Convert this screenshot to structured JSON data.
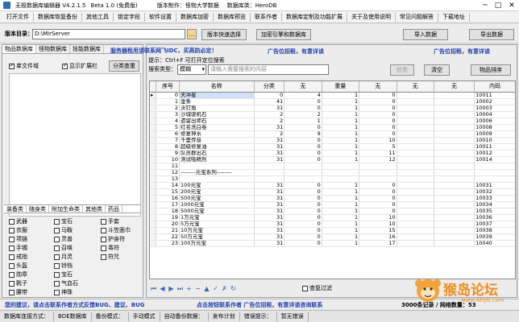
{
  "window": {
    "app_name": "无极数据库编辑器 V4.2.1.5",
    "version": "Beta 1.0 (免费版)",
    "author": "版本制作：怪物大学数据",
    "db_type": "数据库类：HeroDB",
    "minimize": "─",
    "maximize": "□",
    "close": "✕"
  },
  "menu": [
    "打开文件",
    "数据库恢复备份",
    "其他工具",
    "锁定字段",
    "软件设置",
    "数据库加密",
    "数据库预览",
    "联系作者",
    "数据库定制及功能扩展",
    "关于及使用说明",
    "常见问题解答",
    "下载地址"
  ],
  "rootbar": {
    "label": "版本目录：",
    "path": "D:\\MirServer",
    "browse_icon": "…",
    "version_button": "版本快速选择",
    "encrypt_button": "加密引擎和数据库",
    "import_button": "导入数据",
    "export_button": "导出数据"
  },
  "left": {
    "tabs": [
      "物品数据库",
      "怪物数据库",
      "技能数据库"
    ],
    "ad_text": "服务器租用请联系网飞IDC，买高防必定！",
    "checkbox_single": "单文件域",
    "checkbox_show_all": "显示扩展栏",
    "classify_button": "分类查重",
    "bottom_tabs": [
      "装备类",
      "随身类",
      "附加生命类",
      "其他类",
      "药品"
    ],
    "items": [
      "武器",
      "衣服",
      "项链",
      "手镯",
      "戒指",
      "头盔",
      "勋章",
      "靴子",
      "腰带",
      "宝石",
      "马鞍",
      "灵兽",
      "召唤",
      "月灵",
      "铃铛",
      "宝石",
      "气血石",
      "神珠",
      "手套",
      "斗笠面巾",
      "护身符",
      "毒符",
      "符咒"
    ]
  },
  "main": {
    "ad_left": "广告位招租，有意详谈",
    "ad_right": "广告位招租，有意详谈",
    "hint": "提示：Ctrl+F 可打开定位搜索",
    "search_label": "搜索类型：",
    "search_type": "模糊",
    "search_placeholder": "请输入需要搜索的内容",
    "search_button": "检索",
    "clear_button": "清空",
    "sort_button": "物品排序",
    "columns": [
      "序号",
      "名称",
      "分类",
      "无",
      "重量",
      "无",
      "无",
      "无",
      "内码"
    ],
    "rows": [
      [
        "0",
        "天冲星",
        "0",
        "4",
        "1",
        "0",
        "",
        "",
        "10011"
      ],
      [
        "1",
        "金条",
        "41",
        "0",
        "1",
        "0",
        "",
        "",
        "10002"
      ],
      [
        "2",
        "沃钉角",
        "31",
        "0",
        "1",
        "0",
        "",
        "",
        "10003"
      ],
      [
        "3",
        "沙城驱机石",
        "2",
        "2",
        "1",
        "0",
        "",
        "",
        "10004"
      ],
      [
        "4",
        "遗留出师石",
        "2",
        "1",
        "1",
        "0",
        "",
        "",
        "10006"
      ],
      [
        "5",
        "红名洗白卷",
        "31",
        "0",
        "1",
        "0",
        "",
        "",
        "10008"
      ],
      [
        "6",
        "修复神水",
        "2",
        "9",
        "1",
        "0",
        "",
        "",
        "10009"
      ],
      [
        "7",
        "千里传音",
        "31",
        "0",
        "1",
        "10",
        "",
        "",
        "10010"
      ],
      [
        "8",
        "超级修复油",
        "31",
        "0",
        "1",
        "5",
        "",
        "",
        "10011"
      ],
      [
        "9",
        "队员群出石",
        "31",
        "0",
        "1",
        "11",
        "",
        "",
        "10012"
      ],
      [
        "10",
        "测试吸精剂",
        "31",
        "0",
        "1",
        "12",
        "",
        "",
        "10014"
      ],
      [
        "11",
        "",
        "",
        "",
        "",
        "",
        "",
        "",
        ""
      ],
      [
        "12",
        "--------元宝系列--------",
        "",
        "",
        "",
        "",
        "",
        "",
        ""
      ],
      [
        "13",
        "",
        "",
        "",
        "",
        "",
        "",
        "",
        ""
      ],
      [
        "14",
        "100元宝",
        "31",
        "0",
        "1",
        "0",
        "",
        "",
        "10031"
      ],
      [
        "15",
        "200元宝",
        "31",
        "0",
        "1",
        "0",
        "",
        "",
        "10032"
      ],
      [
        "16",
        "500元宝",
        "31",
        "0",
        "1",
        "0",
        "",
        "",
        "10033"
      ],
      [
        "17",
        "1000元宝",
        "31",
        "0",
        "1",
        "0",
        "",
        "",
        "10034"
      ],
      [
        "18",
        "5000元宝",
        "31",
        "0",
        "1",
        "0",
        "",
        "",
        "10035"
      ],
      [
        "19",
        "1万元宝",
        "31",
        "0",
        "1",
        "10",
        "",
        "",
        "10036"
      ],
      [
        "20",
        "5万元宝",
        "31",
        "0",
        "1",
        "10",
        "",
        "",
        "10037"
      ],
      [
        "21",
        "10万元宝",
        "31",
        "0",
        "1",
        "15",
        "",
        "",
        "10038"
      ],
      [
        "22",
        "50万元宝",
        "31",
        "0",
        "1",
        "16",
        "",
        "",
        "10039"
      ],
      [
        "23",
        "100万元宝",
        "31",
        "0",
        "1",
        "17",
        "",
        "",
        "10040"
      ]
    ],
    "filter_checkbox": "查复过滤"
  },
  "status1": {
    "left": "您的建议，请点击联系作者方式反馈BUG、建议、BUG",
    "middle": "点击按钮联系作者 广告位招租，有意详谈咨询联系",
    "right": "3000条记录 / 网络数量：53"
  },
  "status2": [
    "数据库连接方式：",
    "BDE数据库",
    "备份模式：",
    "手动模式",
    "自动备份数据：",
    "发布计划",
    "错误提示：",
    "暂无错误"
  ],
  "watermark": {
    "text": "猴岛论坛",
    "sub": "www.Ahyb.com"
  }
}
